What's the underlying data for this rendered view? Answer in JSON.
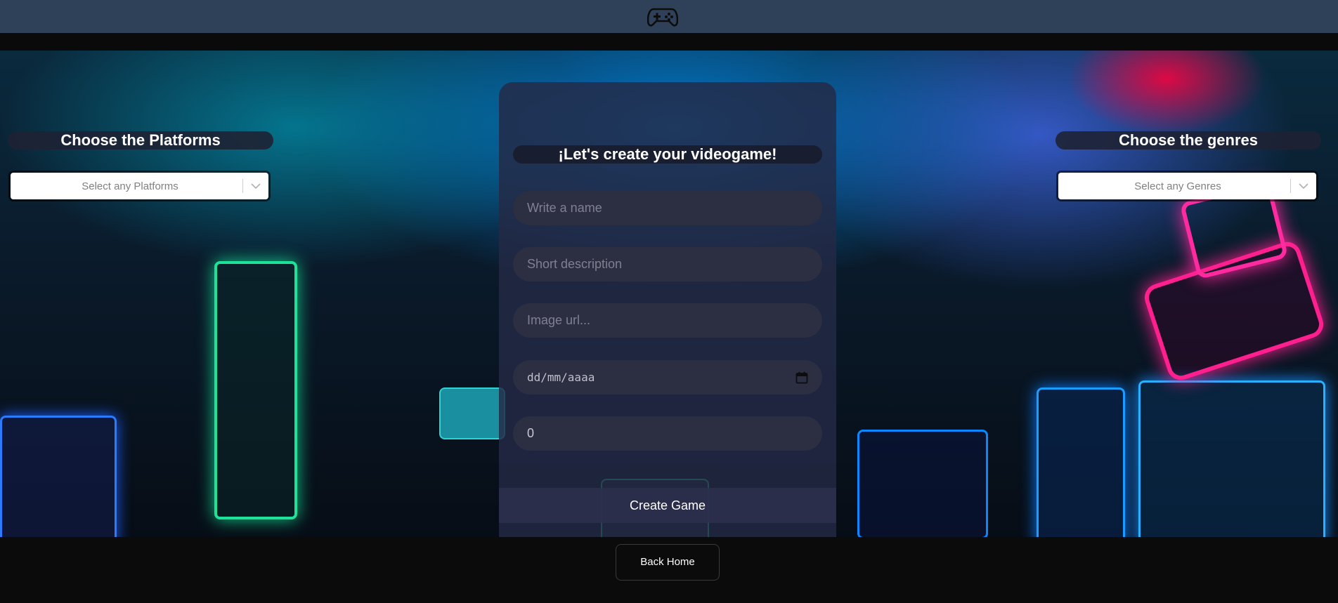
{
  "header": {
    "logo_icon": "gamepad-icon"
  },
  "platforms": {
    "title": "Choose the Platforms",
    "placeholder": "Select any Platforms"
  },
  "genres": {
    "title": "Choose the genres",
    "placeholder": "Select any Genres"
  },
  "form": {
    "title": "¡Let's create your videogame!",
    "name_placeholder": "Write a name",
    "description_placeholder": "Short description",
    "image_placeholder": "Image url...",
    "date_placeholder": "dd/mm/aaaa",
    "rating_value": "0",
    "submit_label": "Create Game"
  },
  "footer": {
    "back_label": "Back Home"
  },
  "colors": {
    "topbar": "#2f4158",
    "panel": "#242a46",
    "field": "#2c2e42",
    "background": "#0b0b0b"
  }
}
